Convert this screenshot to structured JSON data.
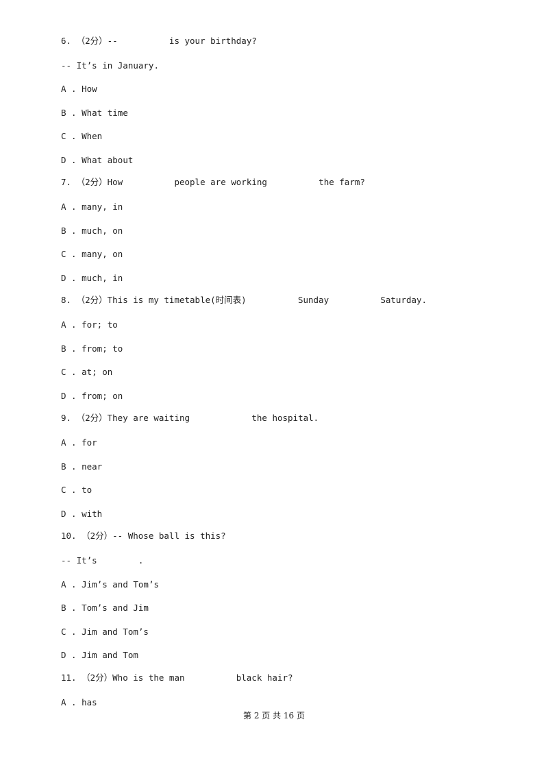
{
  "questions": [
    {
      "number": "6.",
      "score": "（2分）",
      "stem": "--          is your birthday?",
      "followup": "-- It’s in January.",
      "options": [
        {
          "letter": "A .",
          "text": "How"
        },
        {
          "letter": "B .",
          "text": "What time"
        },
        {
          "letter": "C .",
          "text": "When"
        },
        {
          "letter": "D .",
          "text": "What about"
        }
      ]
    },
    {
      "number": "7.",
      "score": "（2分）",
      "stem": "How          people are working          the farm?",
      "options": [
        {
          "letter": "A .",
          "text": "many, in"
        },
        {
          "letter": "B .",
          "text": "much, on"
        },
        {
          "letter": "C .",
          "text": "many, on"
        },
        {
          "letter": "D .",
          "text": "much, in"
        }
      ]
    },
    {
      "number": "8.",
      "score": "（2分）",
      "stem": "This is my timetable(时间表)          Sunday          Saturday.",
      "options": [
        {
          "letter": "A .",
          "text": "for; to"
        },
        {
          "letter": "B .",
          "text": "from; to"
        },
        {
          "letter": "C .",
          "text": "at; on"
        },
        {
          "letter": "D .",
          "text": "from; on"
        }
      ]
    },
    {
      "number": "9.",
      "score": "（2分）",
      "stem": "They are waiting            the hospital.",
      "options": [
        {
          "letter": "A .",
          "text": "for"
        },
        {
          "letter": "B .",
          "text": "near"
        },
        {
          "letter": "C .",
          "text": "to"
        },
        {
          "letter": "D .",
          "text": "with"
        }
      ]
    },
    {
      "number": "10.",
      "score": "（2分）",
      "stem": "-- Whose ball is this?",
      "followup": "-- It’s        .",
      "options": [
        {
          "letter": "A .",
          "text": "Jim’s and Tom’s"
        },
        {
          "letter": "B .",
          "text": "Tom’s and Jim"
        },
        {
          "letter": "C .",
          "text": "Jim and Tom’s"
        },
        {
          "letter": "D .",
          "text": "Jim and Tom"
        }
      ]
    },
    {
      "number": "11.",
      "score": "（2分）",
      "stem": "Who is the man          black hair?",
      "options": [
        {
          "letter": "A .",
          "text": "has"
        }
      ]
    }
  ],
  "footer": {
    "page_label": "第 2 页 共 16 页"
  }
}
